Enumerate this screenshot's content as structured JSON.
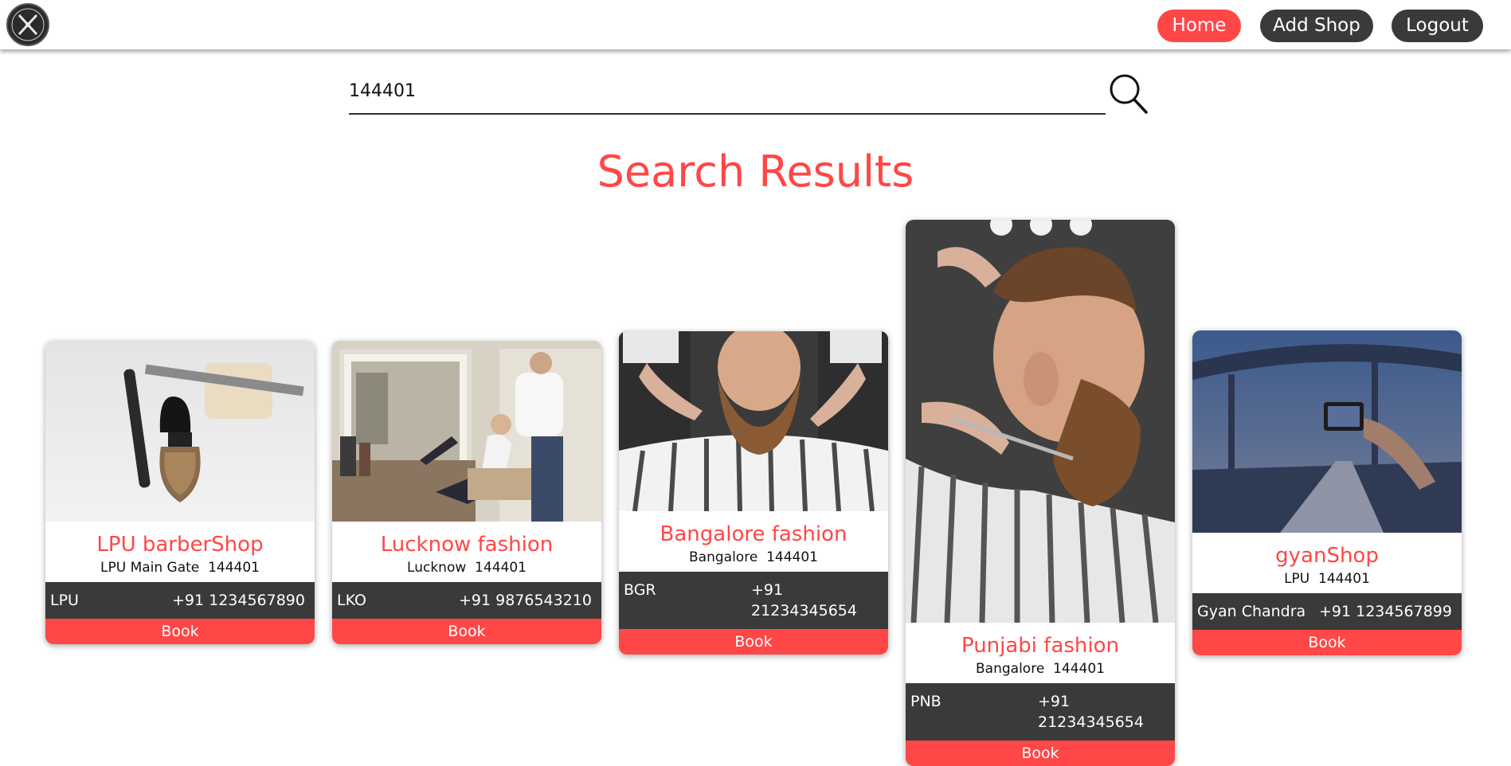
{
  "nav": {
    "logo_icon": "barber-logo-icon",
    "home_label": "Home",
    "add_shop_label": "Add Shop",
    "logout_label": "Logout",
    "accent": "#ff4747",
    "dark": "#3a3a3a"
  },
  "search": {
    "value": "144401",
    "icon": "search-icon"
  },
  "results": {
    "title": "Search Results"
  },
  "cards": [
    {
      "name": "LPU barberShop",
      "address": "LPU Main Gate  144401",
      "owner": "LPU",
      "phone": "+91 1234567890",
      "book_label": "Book",
      "image": "shaving-brush-razor-image"
    },
    {
      "name": "Lucknow fashion",
      "address": "Lucknow  144401",
      "owner": "LKO",
      "phone": "+91 9876543210",
      "book_label": "Book",
      "image": "salon-interior-image"
    },
    {
      "name": "Bangalore fashion",
      "address": "Bangalore  144401",
      "owner": "BGR",
      "phone": "+91 21234345654",
      "book_label": "Book",
      "image": "bearded-man-image"
    },
    {
      "name": "Punjabi fashion",
      "address": "Bangalore  144401",
      "owner": "PNB",
      "phone": "+91 21234345654",
      "book_label": "Book",
      "image": "beard-trim-profile-image"
    },
    {
      "name": "gyanShop",
      "address": "LPU  144401",
      "owner": "Gyan Chandra",
      "phone": "+91 1234567899",
      "book_label": "Book",
      "image": "road-bridge-photo-image"
    }
  ]
}
